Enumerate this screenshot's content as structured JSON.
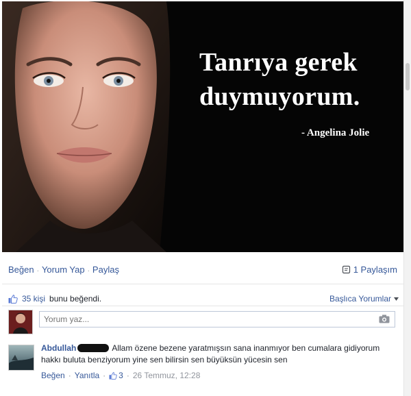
{
  "post": {
    "quote_line1": "Tanrıya gerek",
    "quote_line2": "duymuyorum.",
    "attribution": "- Angelina Jolie"
  },
  "actions": {
    "like": "Beğen",
    "comment": "Yorum Yap",
    "share": "Paylaş",
    "shares_count": "1 Paylaşım"
  },
  "likes": {
    "count_text": "35 kişi",
    "suffix": "bunu beğendi.",
    "top_comments": "Başlıca Yorumlar"
  },
  "comment_box": {
    "placeholder": "Yorum yaz..."
  },
  "comment": {
    "author": "Abdullah",
    "text": "Allam özene bezene yaratmışsın sana inanmıyor ben cumalara gidiyorum hakkı buluta benziyorum yine sen bilirsin sen büyüksün yücesin sen",
    "like_label": "Beğen",
    "reply_label": "Yanıtla",
    "like_count": "3",
    "date": "26 Temmuz, 12:28"
  },
  "icons": {
    "share": "share-count-icon",
    "thumbs_up": "thumbs-up-icon",
    "camera": "camera-icon",
    "dropdown": "caret-down-icon"
  },
  "colors": {
    "link": "#365899",
    "image_bg": "#050505",
    "muted": "#90949c"
  }
}
